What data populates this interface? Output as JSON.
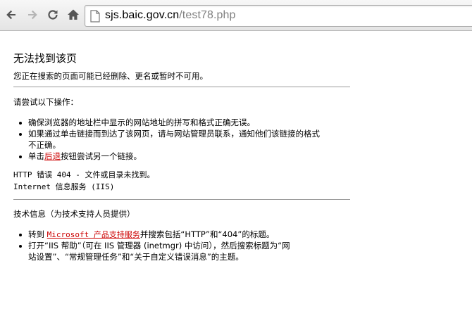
{
  "browser": {
    "url_host": "sjs.baic.gov.cn",
    "url_path": "/test78.php",
    "icons": [
      "back-arrow-icon",
      "forward-arrow-icon",
      "reload-icon",
      "home-icon",
      "page-icon"
    ]
  },
  "error_page": {
    "title": "无法找到该页",
    "subtitle": "您正在搜索的页面可能已经删除、更名或暂时不可用。",
    "try_heading": "请尝试以下操作：",
    "try_items": [
      "确保浏览器的地址栏中显示的网站地址的拼写和格式正确无误。",
      "如果通过单击链接而到达了该网页，请与网站管理员联系，通知他们该链接的格式",
      "不正确。"
    ],
    "back_prefix": "单击",
    "back_link": "后退",
    "back_suffix": "按钮尝试另一个链接。",
    "http_error": "HTTP 错误 404 - 文件或目录未找到。",
    "iis_line": "Internet 信息服务 (IIS)",
    "tech_heading": "技术信息（为技术支持人员提供）",
    "tech_item1_prefix": "转到 ",
    "tech_item1_link": "Microsoft 产品支持服务",
    "tech_item1_suffix": "并搜索包括“HTTP”和“404”的标题。",
    "tech_item2_line1": "打开“IIS 帮助”（可在 IIS 管理器 (inetmgr) 中访问），然后搜索标题为“网",
    "tech_item2_line2": "站设置”、“常规管理任务”和“关于自定义错误消息”的主题。"
  }
}
